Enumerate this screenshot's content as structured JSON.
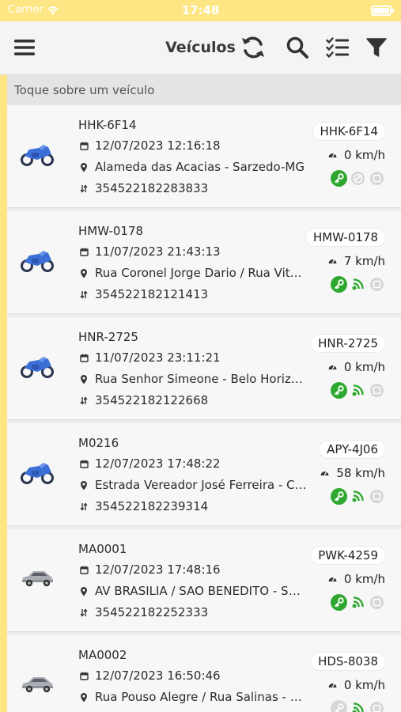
{
  "status_bar": {
    "carrier": "Carrier",
    "time": "17:48"
  },
  "header": {
    "title": "Veículos"
  },
  "hint": "Toque sobre um veículo",
  "colors": {
    "accent": "#fde683",
    "ok": "#2ea82e",
    "moto": "#3b6fd6",
    "car": "#8e9298"
  },
  "vehicles": [
    {
      "type": "motorcycle",
      "name": "HHK-6F14",
      "datetime": "12/07/2023 12:16:18",
      "address": "Alameda das Acacias - Sarzedo-MG",
      "imei": "354522182283833",
      "plate": "HHK-6F14",
      "speed": "0 km/h",
      "ignition": "on",
      "signal": "off"
    },
    {
      "type": "motorcycle",
      "name": "HMW-0178",
      "datetime": "11/07/2023 21:43:13",
      "address": "Rua Coronel Jorge Dario / Rua Vitó…",
      "imei": "354522182121413",
      "plate": "HMW-0178",
      "speed": "7 km/h",
      "ignition": "on",
      "signal": "on"
    },
    {
      "type": "motorcycle",
      "name": "HNR-2725",
      "datetime": "11/07/2023 23:11:21",
      "address": "Rua Senhor Simeone - Belo Horizon…",
      "imei": "354522182122668",
      "plate": "HNR-2725",
      "speed": "0 km/h",
      "ignition": "on",
      "signal": "on"
    },
    {
      "type": "motorcycle",
      "name": "M0216",
      "datetime": "12/07/2023 17:48:22",
      "address": "Estrada Vereador José Ferreira - Cont…",
      "imei": "354522182239314",
      "plate": "APY-4J06",
      "speed": "58 km/h",
      "ignition": "on",
      "signal": "on"
    },
    {
      "type": "car",
      "name": "MA0001",
      "datetime": "12/07/2023 17:48:16",
      "address": "AV BRASILIA / SAO BENEDITO - SAN…",
      "imei": "354522182252333",
      "plate": "PWK-4259",
      "speed": "0 km/h",
      "ignition": "on",
      "signal": "on"
    },
    {
      "type": "car",
      "name": "MA0002",
      "datetime": "12/07/2023 16:50:46",
      "address": "Rua Pouso Alegre / Rua Salinas - Bel…",
      "imei": "",
      "plate": "HDS-8038",
      "speed": "0 km/h",
      "ignition": "off",
      "signal": "on"
    }
  ]
}
